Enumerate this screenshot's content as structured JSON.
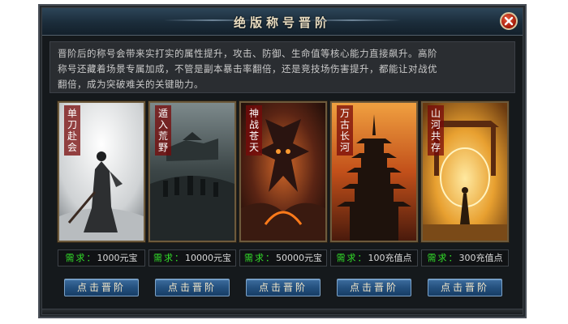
{
  "dialog": {
    "title": "绝版称号晋阶",
    "description_line1": "晋阶后的称号会带来实打实的属性提升，攻击、防御、生命值等核心能力直接飙升。高阶",
    "description_line2": "称号还藏着场景专属加成，不管是副本暴击率翻倍，还是竞技场伤害提升，都能让对战优",
    "description_line3": "翻倍，成为突破难关的关键助力。",
    "close_icon": "close-icon"
  },
  "cards": [
    {
      "name": "单刀赴会",
      "req_label": "需求：",
      "req_value": "1000元宝",
      "button": "点击晋阶"
    },
    {
      "name": "遁入荒野",
      "req_label": "需求：",
      "req_value": "10000元宝",
      "button": "点击晋阶"
    },
    {
      "name": "神战苍天",
      "req_label": "需求：",
      "req_value": "50000元宝",
      "button": "点击晋阶"
    },
    {
      "name": "万古长河",
      "req_label": "需求：",
      "req_value": "100充值点",
      "button": "点击晋阶"
    },
    {
      "name": "山河共存",
      "req_label": "需求：",
      "req_value": "300充值点",
      "button": "点击晋阶"
    }
  ],
  "colors": {
    "requirement_label": "#33e02a",
    "button_bg": "#24507e",
    "title_text": "#e8dcc0"
  }
}
